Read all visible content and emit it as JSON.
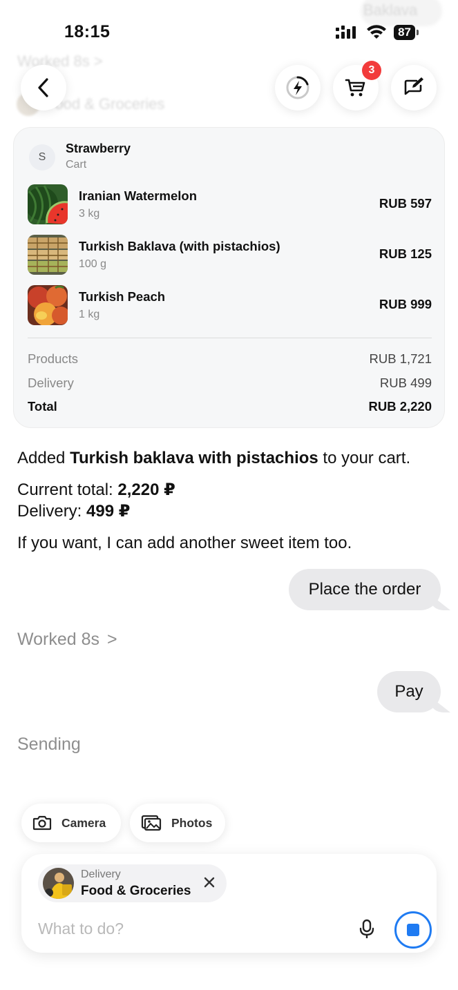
{
  "status_bar": {
    "time": "18:15",
    "battery": "87"
  },
  "background_ghost": {
    "top_pill": "Baklava",
    "worked": "Worked 8s >",
    "store": "Food & Groceries"
  },
  "header": {
    "cart_badge": "3"
  },
  "cart": {
    "store_initial": "S",
    "store_name": "Strawberry",
    "store_sub": "Cart",
    "items": [
      {
        "name": "Iranian Watermelon",
        "qty": "3 kg",
        "price": "RUB 597"
      },
      {
        "name": "Turkish Baklava (with pistachios)",
        "qty": "100 g",
        "price": "RUB 125"
      },
      {
        "name": "Turkish Peach",
        "qty": "1 kg",
        "price": "RUB 999"
      }
    ],
    "summary": {
      "products_label": "Products",
      "products_value": "RUB 1,721",
      "delivery_label": "Delivery",
      "delivery_value": "RUB 499",
      "total_label": "Total",
      "total_value": "RUB 2,220"
    }
  },
  "assistant_message": {
    "line1_pre": "Added ",
    "line1_bold": "Turkish baklava with pistachios",
    "line1_post": " to your cart.",
    "total_label": "Current total: ",
    "total_value": "2,220 ₽",
    "delivery_label": "Delivery: ",
    "delivery_value": "499 ₽",
    "line3": "If you want, I can add another sweet item too."
  },
  "user_message_1": "Place the order",
  "worked": {
    "label": "Worked 8s",
    "chevron": ">"
  },
  "user_message_2": "Pay",
  "sending": "Sending",
  "attachments": {
    "camera": "Camera",
    "photos": "Photos"
  },
  "composer": {
    "context_sub": "Delivery",
    "context_title": "Food & Groceries",
    "placeholder": "What to do?"
  },
  "colors": {
    "accent": "#1f7bf2",
    "badge": "#f23b3b",
    "bubble": "#e9e9eb"
  }
}
